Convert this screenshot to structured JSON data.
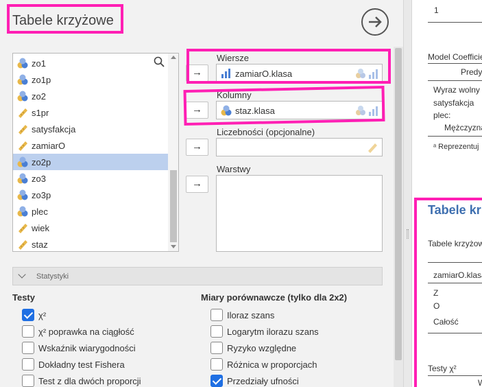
{
  "title": "Tabele krzyżowe",
  "variables": [
    {
      "name": "zo1",
      "type": "nominal"
    },
    {
      "name": "zo1p",
      "type": "nominal"
    },
    {
      "name": "zo2",
      "type": "nominal"
    },
    {
      "name": "s1pr",
      "type": "continuous"
    },
    {
      "name": "satysfakcja",
      "type": "continuous"
    },
    {
      "name": "zamiarO",
      "type": "continuous"
    },
    {
      "name": "zo2p",
      "type": "nominal",
      "selected": true
    },
    {
      "name": "zo3",
      "type": "nominal"
    },
    {
      "name": "zo3p",
      "type": "nominal"
    },
    {
      "name": "plec",
      "type": "nominal"
    },
    {
      "name": "wiek",
      "type": "continuous"
    },
    {
      "name": "staz",
      "type": "continuous"
    }
  ],
  "targets": {
    "rows": {
      "label": "Wiersze",
      "value": "zamiarO.klasa"
    },
    "cols": {
      "label": "Kolumny",
      "value": "staz.klasa"
    },
    "counts": {
      "label": "Liczebności (opcjonalne)"
    },
    "layers": {
      "label": "Warstwy"
    }
  },
  "stats_title": "Statystyki",
  "tests": {
    "heading": "Testy",
    "items": [
      {
        "label": "χ²",
        "checked": true
      },
      {
        "label": "χ² poprawka na ciągłość",
        "checked": false
      },
      {
        "label": "Wskaźnik wiarygodności",
        "checked": false
      },
      {
        "label": "Dokładny test Fishera",
        "checked": false
      },
      {
        "label": "Test z dla dwóch proporcji",
        "checked": false
      }
    ]
  },
  "comparative": {
    "heading": "Miary porównawcze (tylko dla 2x2)",
    "items": [
      {
        "label": "Iloraz szans",
        "checked": false
      },
      {
        "label": "Logarytm ilorazu szans",
        "checked": false
      },
      {
        "label": "Ryzyko względne",
        "checked": false
      },
      {
        "label": "Różnica w proporcjach",
        "checked": false
      },
      {
        "label": "Przedziały ufności",
        "checked": true
      }
    ]
  },
  "results": {
    "top_value": "1",
    "model_coeff": "Model Coefficie",
    "predy": "Predy",
    "intercept": "Wyraz wolny ᵃ",
    "satysfakcja": "satysfakcja",
    "plec": "plec:",
    "mezczyzna": "Mężczyzna",
    "footnote": "ᵃ Reprezentuj",
    "crosstab_title": "Tabele kr",
    "crosstab_sub": "Tabele krzyżow",
    "row_var": "zamiarO.klasa",
    "row_z": "Z",
    "row_o": "O",
    "row_total": "Całość",
    "tests_label": "Testy χ²",
    "col_w": "W"
  },
  "colors": {
    "highlight": "#ff1fb4",
    "selected_row": "#bcd0ee",
    "accent": "#1f6fe3",
    "results_title": "#3e6fb0"
  }
}
